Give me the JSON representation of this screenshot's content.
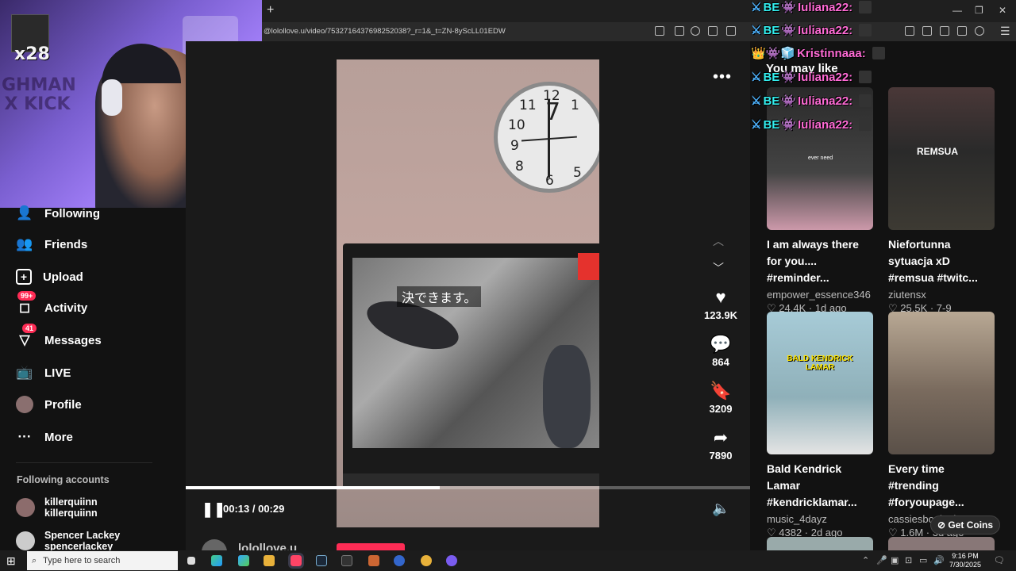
{
  "browser": {
    "new_tab": "+",
    "url": "@lolollove.u/video/7532716437698252038?_r=1&_t=ZN-8yScLL01EDW",
    "window_controls": [
      "—",
      "❐",
      "✕"
    ]
  },
  "webcam": {
    "badge_text": "x28",
    "watermark": "GHMAN X KICK"
  },
  "chat": [
    {
      "user": "Iuliana22:"
    },
    {
      "user": "Iuliana22:"
    },
    {
      "user": "Kristinnaaa:"
    },
    {
      "user": "Iuliana22:"
    },
    {
      "user": "Iuliana22:"
    },
    {
      "user": "Iuliana22:"
    }
  ],
  "sidebar": {
    "items": [
      {
        "label": "Following",
        "icon": "following-icon"
      },
      {
        "label": "Friends",
        "icon": "friends-icon"
      },
      {
        "label": "Upload",
        "icon": "upload-icon"
      },
      {
        "label": "Activity",
        "icon": "activity-icon",
        "badge": "99+"
      },
      {
        "label": "Messages",
        "icon": "messages-icon",
        "badge": "41"
      },
      {
        "label": "LIVE",
        "icon": "live-icon"
      },
      {
        "label": "Profile",
        "icon": "profile-icon"
      },
      {
        "label": "More",
        "icon": "more-icon"
      }
    ],
    "following_heading": "Following accounts",
    "accounts": [
      {
        "name": "killerquiinn",
        "handle": "killerquiinn"
      },
      {
        "name": "Spencer Lackey",
        "handle": "spencerlackey"
      }
    ]
  },
  "video": {
    "tv_caption": "決できます。",
    "likes": "123.9K",
    "comments": "864",
    "saves": "3209",
    "shares": "7890",
    "time": "00:13 / 00:29",
    "progress": 0.45,
    "author": "lolollove.u"
  },
  "recommendations": {
    "heading": "You may like",
    "items": [
      {
        "title": "I am always there for you.... #reminder...",
        "author": "empower_essence346",
        "meta": "♡ 24.4K · 1d ago",
        "overlay": "ever need",
        "bg": "#2b2b2b"
      },
      {
        "title": "Niefortunna sytuacja xD #remsua #twitc...",
        "author": "ziutensx",
        "meta": "♡ 25.5K · 7-9",
        "overlay": "REMSUA",
        "bg": "#3a3530"
      },
      {
        "title": "Bald Kendrick Lamar #kendricklamar...",
        "author": "music_4dayz",
        "meta": "♡ 4382 · 2d ago",
        "overlay": "BALD KENDRICK LAMAR",
        "bg": "#8fb7c7"
      },
      {
        "title": "Every time #trending #foryoupage...",
        "author": "cassiesbooktok",
        "meta": "♡ 1.6M · 3d ago",
        "overlay": "",
        "bg": "#8a7a6a"
      }
    ],
    "get_coins": "Get Coins"
  },
  "taskbar": {
    "search_placeholder": "Type here to search",
    "time": "9:16 PM",
    "date": "7/30/2025"
  },
  "colors": {
    "accent": "#fe2c55",
    "background": "#121212"
  }
}
